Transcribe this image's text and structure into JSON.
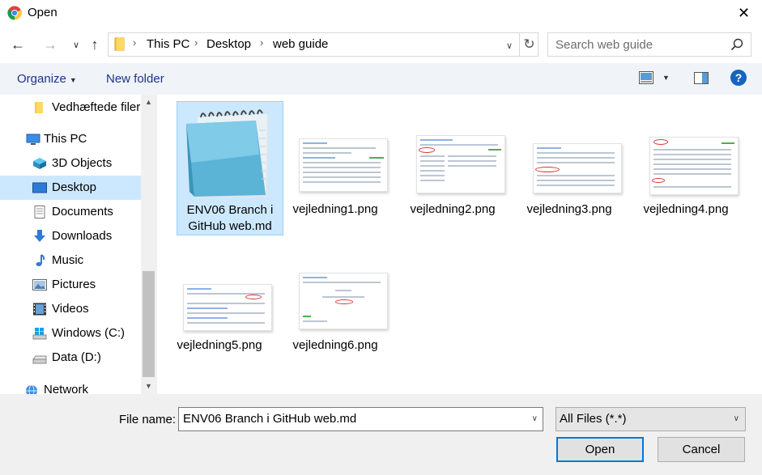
{
  "window": {
    "title": "Open",
    "app_icon": "chrome-icon",
    "close_glyph": "✕"
  },
  "nav": {
    "back_glyph": "←",
    "forward_glyph": "→",
    "recent_glyph": "∨",
    "up_glyph": "↑",
    "breadcrumb": [
      "This PC",
      "Desktop",
      "web guide"
    ],
    "separator": "›",
    "dropdown_glyph": "∨",
    "refresh_glyph": "↻"
  },
  "search": {
    "placeholder": "Search web guide"
  },
  "toolbar": {
    "organize_label": "Organize",
    "organize_caret": "▼",
    "new_folder_label": "New folder",
    "view_caret": "▼",
    "help_label": "?"
  },
  "sidebar": {
    "items": [
      {
        "label": "Vedhæftede filer",
        "icon": "folder-icon"
      },
      {
        "label": "This PC",
        "icon": "computer-icon"
      },
      {
        "label": "3D Objects",
        "icon": "cube-icon"
      },
      {
        "label": "Desktop",
        "icon": "desktop-icon",
        "selected": true
      },
      {
        "label": "Documents",
        "icon": "document-icon"
      },
      {
        "label": "Downloads",
        "icon": "download-icon"
      },
      {
        "label": "Music",
        "icon": "music-icon"
      },
      {
        "label": "Pictures",
        "icon": "pictures-icon"
      },
      {
        "label": "Videos",
        "icon": "video-icon"
      },
      {
        "label": "Windows (C:)",
        "icon": "windows-drive-icon"
      },
      {
        "label": "Data (D:)",
        "icon": "drive-icon"
      },
      {
        "label": "Network",
        "icon": "network-icon"
      }
    ],
    "scroll_up_glyph": "▲",
    "scroll_down_glyph": "▼"
  },
  "files": [
    {
      "name_line1": "ENV06 Branch i",
      "name_line2": "GitHub web.md",
      "icon": "notepad-icon",
      "selected": true
    },
    {
      "name_line1": "vejledning1.png",
      "name_line2": ""
    },
    {
      "name_line1": "vejledning2.png",
      "name_line2": ""
    },
    {
      "name_line1": "vejledning3.png",
      "name_line2": ""
    },
    {
      "name_line1": "vejledning4.png",
      "name_line2": ""
    },
    {
      "name_line1": "vejledning5.png",
      "name_line2": ""
    },
    {
      "name_line1": "vejledning6.png",
      "name_line2": ""
    }
  ],
  "bottom": {
    "file_name_label": "File name:",
    "file_name_value": "ENV06 Branch i GitHub web.md",
    "caret": "∨",
    "filter_value": "All Files (*.*)",
    "open_label": "Open",
    "cancel_label": "Cancel"
  },
  "colors": {
    "selection": "#cce8ff",
    "link_blue": "#1e3287",
    "help_blue": "#1565c0",
    "accent_border": "#0078d7"
  }
}
